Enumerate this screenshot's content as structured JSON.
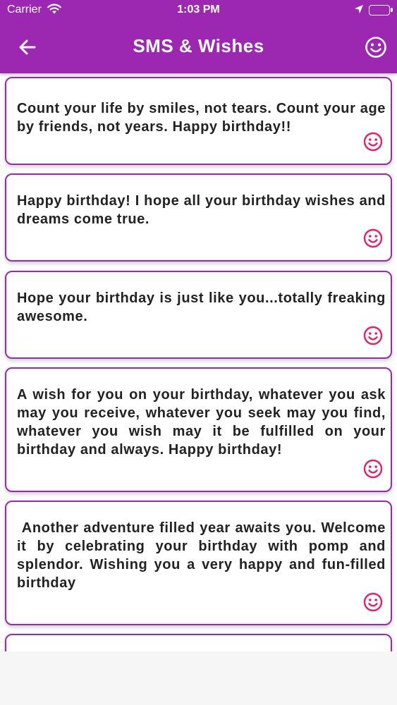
{
  "status_bar": {
    "carrier": "Carrier",
    "time": "1:03 PM"
  },
  "header": {
    "title": "SMS & Wishes",
    "back_icon": "arrow-left-icon",
    "action_icon": "smiley-icon"
  },
  "colors": {
    "primary": "#9c27b0",
    "accent": "#e91e63",
    "text": "#222222"
  },
  "wishes": [
    {
      "text": "Count your life by smiles, not tears. Count your age by friends, not years. Happy birthday!!",
      "icon": "smiley-icon"
    },
    {
      "text": "Happy birthday! I hope all your birthday wishes and dreams come true.",
      "icon": "smiley-icon"
    },
    {
      "text": "Hope your birthday is just like you...totally freaking awesome.",
      "icon": "smiley-icon"
    },
    {
      "text": "A wish for you on your birthday, whatever you ask may you receive, whatever you seek may you find, whatever you wish may it be fulfilled on your birthday and always. Happy birthday!",
      "icon": "smiley-icon"
    },
    {
      "text": " Another adventure filled year awaits you. Welcome it by celebrating your birthday with pomp and splendor. Wishing you a very happy and fun-filled birthday",
      "icon": "smiley-icon"
    }
  ]
}
